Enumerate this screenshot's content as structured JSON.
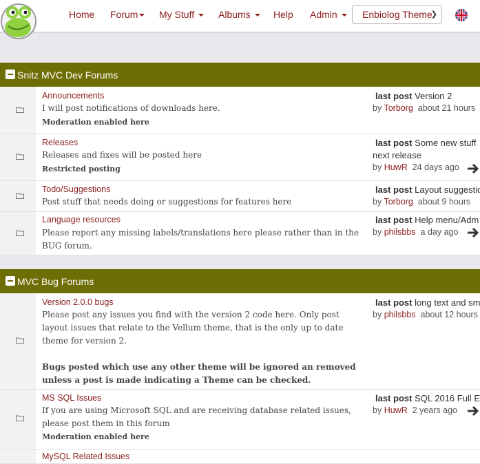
{
  "nav": {
    "home": "Home",
    "forum": "Forum",
    "mystuff": "My Stuff",
    "albums": "Albums",
    "help": "Help",
    "admin": "Admin",
    "theme": "Enbiolog Theme"
  },
  "categories": [
    {
      "title": "Snitz MVC Dev Forums",
      "forums": [
        {
          "name": "Announcements",
          "desc": "I will post notifications of downloads here.",
          "note": "Moderation enabled here",
          "lp_label": "last post",
          "lp_subject": "Version 2",
          "lp_by": "by",
          "lp_user": "Torborg",
          "lp_time": "about 21 hours"
        },
        {
          "name": "Releases",
          "desc": "Releases and fixes will be posted here",
          "note": "Restricted posting",
          "lp_label": "last post",
          "lp_subject": "Some new stuff",
          "lp_subject_cont": "next release",
          "lp_by": "by",
          "lp_user": "HuwR",
          "lp_time": "24 days ago"
        },
        {
          "name": "Todo/Suggestions",
          "desc": "Post stuff that needs doing or suggestions for features here",
          "lp_label": "last post",
          "lp_subject": "Layout suggestio",
          "lp_by": "by",
          "lp_user": "Torborg",
          "lp_time": "about 9 hours"
        },
        {
          "name": "Language resources",
          "desc1": "Please report any missing labels/translations here please rather than in the",
          "desc2": "BUG forum.",
          "lp_label": "last post",
          "lp_subject": "Help menu/Adm",
          "lp_by": "by",
          "lp_user": "philsbbs",
          "lp_time": "a day ago"
        }
      ]
    },
    {
      "title": "MVC Bug Forums",
      "forums": [
        {
          "name": "Version 2.0.0 bugs",
          "desc1": "Please post any issues you find with the version 2 code here. Only post",
          "desc2": "layout issues that relate to the Vellum theme, that is the only up to date",
          "desc3": "theme for version 2.",
          "note1": "Bugs posted which use any other theme will be ignored an removed",
          "note2": "unless a post is made indicating a Theme can be checked.",
          "lp_label": "last post",
          "lp_subject": "long text and sm",
          "lp_by": "by",
          "lp_user": "philsbbs",
          "lp_time": "about 12 hours"
        },
        {
          "name": "MS SQL Issues",
          "desc1": "If you are using Microsoft SQL and are receiving database related issues,",
          "desc2": "please post them in this forum",
          "note": "Moderation enabled here",
          "lp_label": "last post",
          "lp_subject": "SQL 2016 Full Ec",
          "lp_by": "by",
          "lp_user": "HuwR",
          "lp_time": "2 years ago"
        },
        {
          "name": "MySQL Related Issues"
        }
      ]
    }
  ]
}
